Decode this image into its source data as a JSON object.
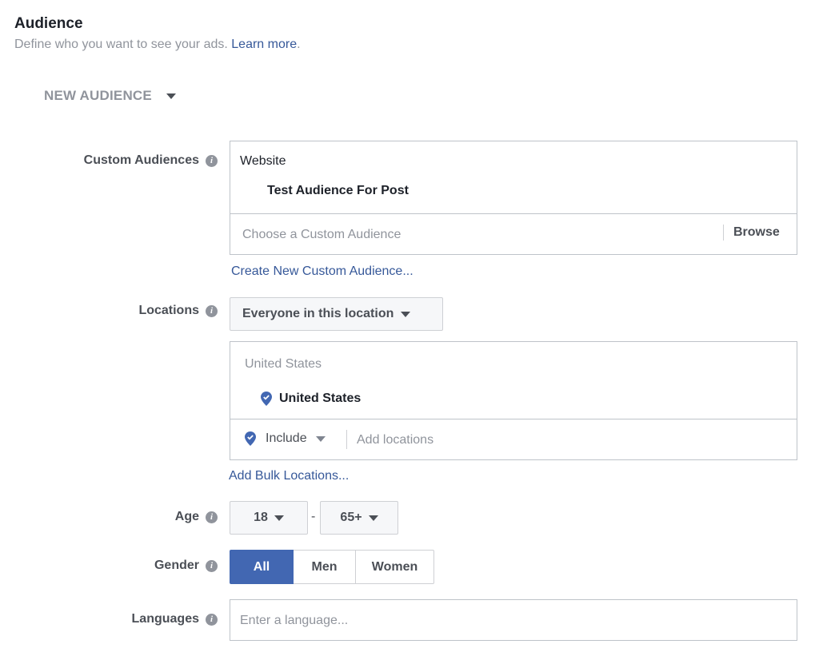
{
  "header": {
    "title": "Audience",
    "subtitle": "Define who you want to see your ads.",
    "learn_more": "Learn more",
    "period": "."
  },
  "audience_selector": {
    "label": "NEW AUDIENCE"
  },
  "custom_audiences": {
    "label": "Custom Audiences",
    "group": "Website",
    "selected": "Test Audience For Post",
    "placeholder": "Choose a Custom Audience",
    "browse": "Browse",
    "create_link": "Create New Custom Audience..."
  },
  "locations": {
    "label": "Locations",
    "dropdown": "Everyone in this location",
    "group": "United States",
    "selected": "United States",
    "include": "Include",
    "placeholder": "Add locations",
    "bulk_link": "Add Bulk Locations..."
  },
  "age": {
    "label": "Age",
    "min": "18",
    "separator": "-",
    "max": "65+"
  },
  "gender": {
    "label": "Gender",
    "options": [
      "All",
      "Men",
      "Women"
    ],
    "selected": "All"
  },
  "languages": {
    "label": "Languages",
    "placeholder": "Enter a language..."
  },
  "colors": {
    "accent": "#4267b2",
    "link": "#365899",
    "border": "#bec3c9"
  }
}
